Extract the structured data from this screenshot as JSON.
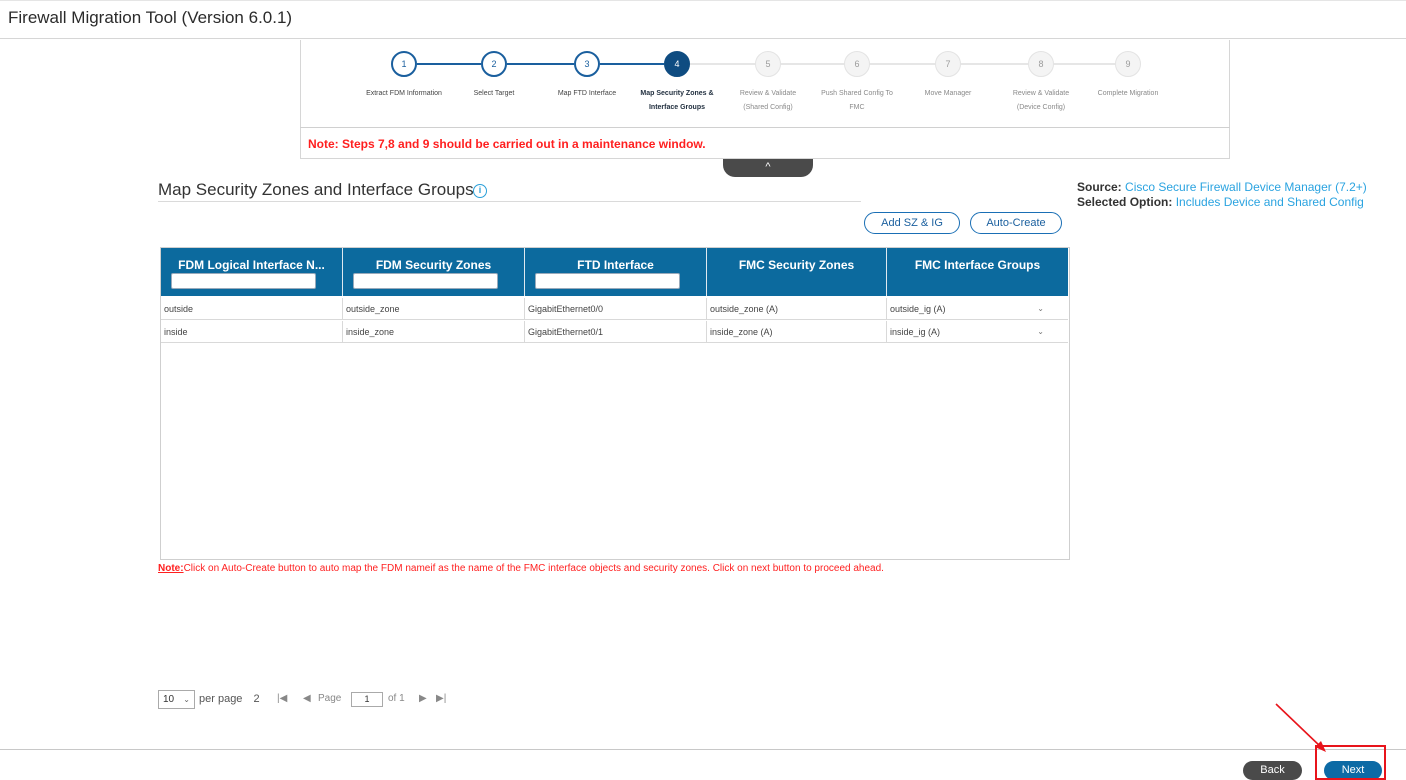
{
  "app": {
    "title": "Firewall Migration Tool (Version 6.0.1)"
  },
  "wizard": {
    "steps": [
      {
        "number": "1",
        "label": "Extract FDM Information",
        "label2": "",
        "state": "done"
      },
      {
        "number": "2",
        "label": "Select Target",
        "label2": "",
        "state": "done"
      },
      {
        "number": "3",
        "label": "Map FTD Interface",
        "label2": "",
        "state": "done"
      },
      {
        "number": "4",
        "label": "Map Security Zones &",
        "label2": "Interface Groups",
        "state": "active"
      },
      {
        "number": "5",
        "label": "Review & Validate",
        "label2": "(Shared Config)",
        "state": "future"
      },
      {
        "number": "6",
        "label": "Push Shared Config To",
        "label2": "FMC",
        "state": "future"
      },
      {
        "number": "7",
        "label": "Move Manager",
        "label2": "",
        "state": "future"
      },
      {
        "number": "8",
        "label": "Review & Validate",
        "label2": "(Device Config)",
        "state": "future"
      },
      {
        "number": "9",
        "label": "Complete Migration",
        "label2": "",
        "state": "future"
      }
    ],
    "note": "Note: Steps 7,8 and 9 should be carried out in a maintenance window.",
    "collapse_glyph": "^"
  },
  "section": {
    "title": "Map Security Zones and Interface Groups",
    "info_glyph": "i",
    "source_key": "Source:",
    "source_value": "Cisco Secure Firewall Device Manager (7.2+)",
    "option_key": "Selected Option:",
    "option_value": "Includes Device and Shared Config",
    "add_button": "Add SZ & IG",
    "auto_button": "Auto-Create"
  },
  "table": {
    "columns": [
      "FDM Logical Interface N...",
      "FDM Security Zones",
      "FTD Interface",
      "FMC Security Zones",
      "FMC Interface Groups"
    ],
    "rows": [
      [
        "outside",
        "outside_zone",
        "GigabitEthernet0/0",
        "outside_zone (A)",
        "outside_ig (A)"
      ],
      [
        "inside",
        "inside_zone",
        "GigabitEthernet0/1",
        "inside_zone (A)",
        "inside_ig (A)"
      ]
    ]
  },
  "bottom_note": {
    "prefix": "Note:",
    "text": "Click on Auto-Create button to auto map the FDM nameif as the name of the FMC interface objects and security zones. Click on next button to proceed ahead."
  },
  "pager": {
    "per_page_value": "10",
    "per_page_label": "per page",
    "total_glyph": "2",
    "first": "|◀",
    "prev": "◀",
    "page_label": "Page",
    "page_value": "1",
    "of_label": "of 1",
    "next": "▶",
    "last": "▶|"
  },
  "footer": {
    "back": "Back",
    "next": "Next"
  },
  "colors": {
    "header_blue": "#0c6a9e",
    "accent_blue": "#2aa3e0",
    "warning_red": "#ff1f1f",
    "highlight_red": "#e8141b"
  }
}
